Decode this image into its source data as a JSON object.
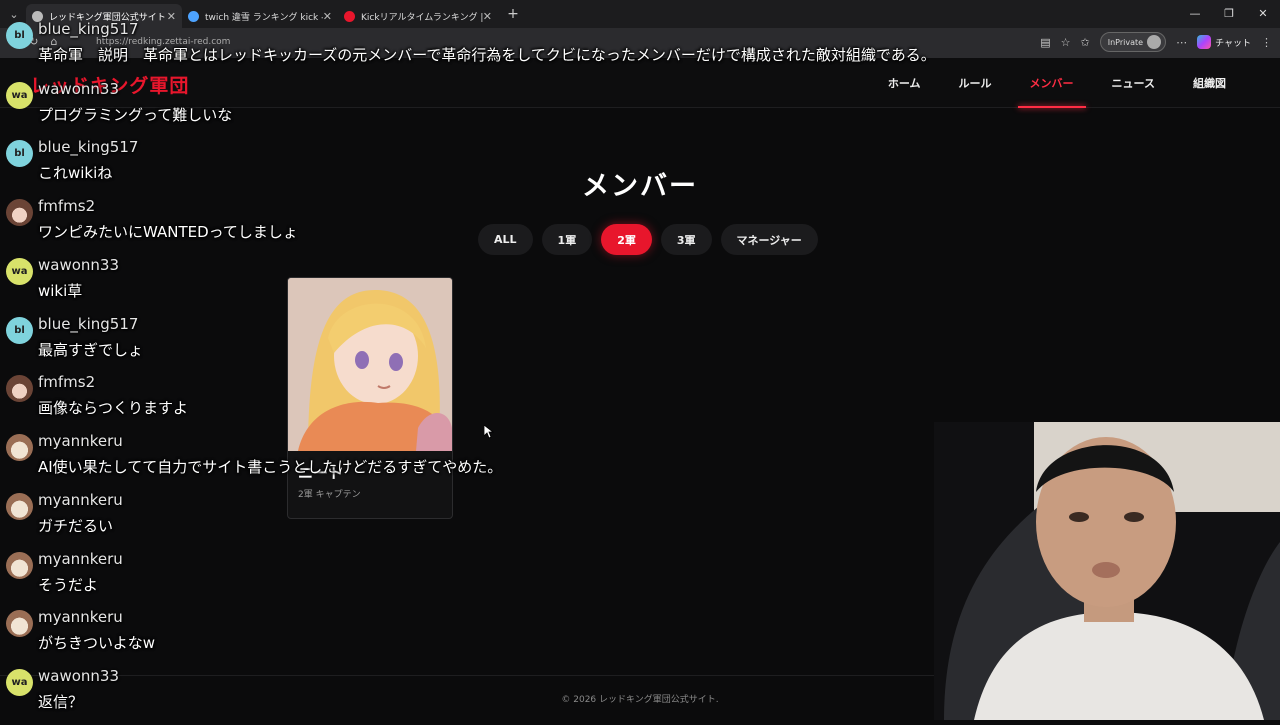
{
  "browser": {
    "tabs": [
      {
        "label": "レッドキング軍団公式サイト",
        "active": true,
        "icon_color": "#bbbbbb"
      },
      {
        "label": "twich 違雪 ランキング kick - 検索",
        "active": false,
        "icon_color": "#4da3ff"
      },
      {
        "label": "Kickリアルタイムランキング | 配信者数",
        "active": false,
        "icon_color": "#e8162c"
      }
    ],
    "url": "https://redking.zettai-red.com",
    "inprivate_label": "InPrivate",
    "copilot_label": "チャット"
  },
  "site": {
    "logo": "レッドキング軍団",
    "nav": [
      {
        "label": "ホーム",
        "active": false
      },
      {
        "label": "ルール",
        "active": false
      },
      {
        "label": "メンバー",
        "active": true
      },
      {
        "label": "ニュース",
        "active": false
      },
      {
        "label": "組織図",
        "active": false
      }
    ],
    "page_title": "メンバー",
    "filters": [
      {
        "label": "ALL",
        "active": false
      },
      {
        "label": "1軍",
        "active": false
      },
      {
        "label": "2軍",
        "active": true
      },
      {
        "label": "3軍",
        "active": false
      },
      {
        "label": "マネージャー",
        "active": false
      }
    ],
    "card": {
      "name": "ニート",
      "role": "2軍 キャプテン"
    },
    "footer": "© 2026 レッドキング軍団公式サイト."
  },
  "colors": {
    "accent": "#e8162c",
    "background": "#0b0b0c"
  },
  "chat": [
    {
      "user": "blue_king517",
      "avatar": "bl",
      "avatar_type": "bl",
      "text": "革命軍　説明　革命軍とはレッドキッカーズの元メンバーで革命行為をしてクビになったメンバーだけで構成された敵対組織である。"
    },
    {
      "user": "wawonn33",
      "avatar": "wa",
      "avatar_type": "wa",
      "text": "プログラミングって難しいな"
    },
    {
      "user": "blue_king517",
      "avatar": "bl",
      "avatar_type": "bl",
      "text": "これwikiね"
    },
    {
      "user": "fmfms2",
      "avatar": "",
      "avatar_type": "girl",
      "text": "ワンピみたいにWANTEDってしましょ"
    },
    {
      "user": "wawonn33",
      "avatar": "wa",
      "avatar_type": "wa",
      "text": "wiki草"
    },
    {
      "user": "blue_king517",
      "avatar": "bl",
      "avatar_type": "bl",
      "text": "最高すぎでしょ"
    },
    {
      "user": "fmfms2",
      "avatar": "",
      "avatar_type": "girl",
      "text": "画像ならつくりますよ"
    },
    {
      "user": "myannkeru",
      "avatar": "",
      "avatar_type": "cat",
      "text": "AI使い果たしてて自力でサイト書こうとしたけどだるすぎてやめた。"
    },
    {
      "user": "myannkeru",
      "avatar": "",
      "avatar_type": "cat",
      "text": "ガチだるい"
    },
    {
      "user": "myannkeru",
      "avatar": "",
      "avatar_type": "cat",
      "text": "そうだよ"
    },
    {
      "user": "myannkeru",
      "avatar": "",
      "avatar_type": "cat",
      "text": "がちきついよなw"
    },
    {
      "user": "wawonn33",
      "avatar": "wa",
      "avatar_type": "wa",
      "text": "返信？"
    }
  ]
}
